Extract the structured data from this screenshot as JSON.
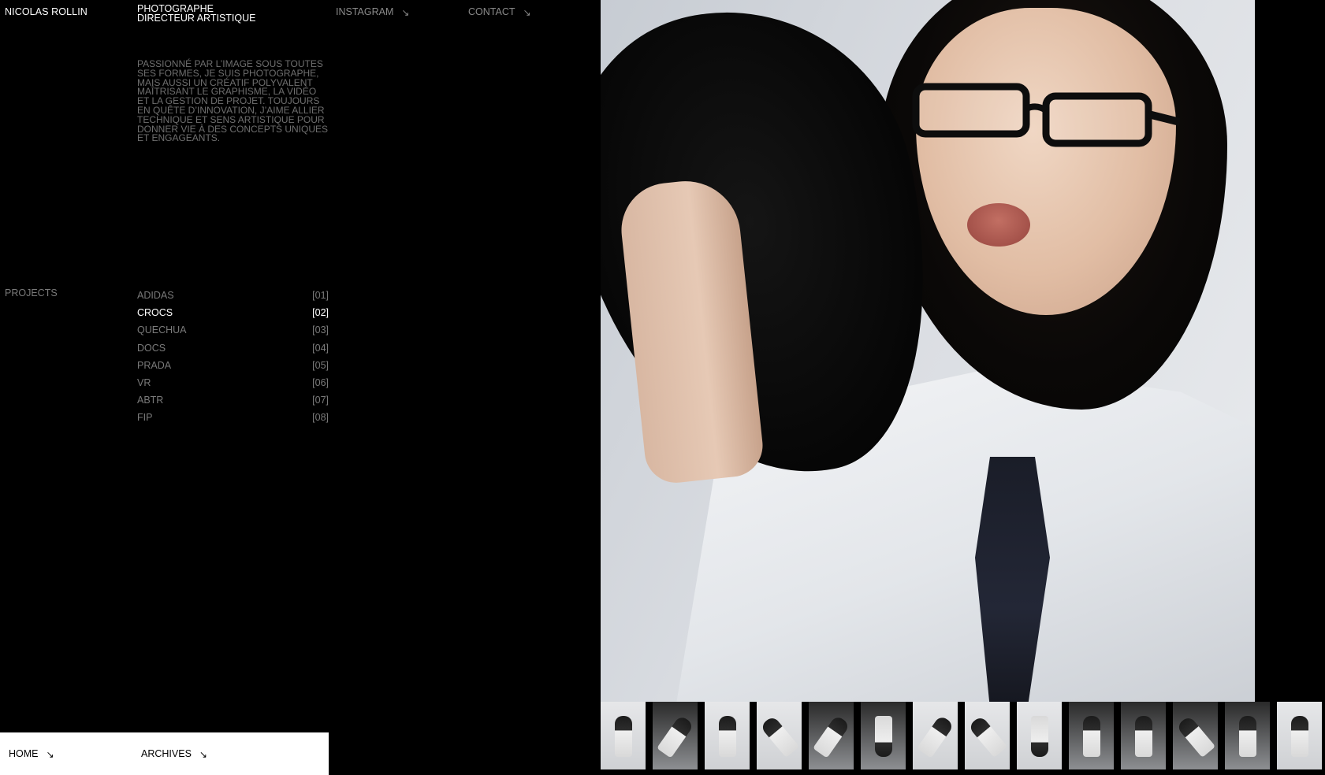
{
  "header": {
    "name": "NICOLAS ROLLIN",
    "role_line1": "PHOTOGRAPHE",
    "role_line2": "DIRECTEUR ARTISTIQUE",
    "instagram_label": "INSTAGRAM",
    "contact_label": "CONTACT",
    "arrow_glyph": "↘"
  },
  "intro": {
    "text": "PASSIONNÉ PAR L’IMAGE SOUS TOUTES SES FORMES, JE SUIS PHOTOGRAPHE, MAIS AUSSI UN CRÉATIF POLYVALENT MAÎTRISANT LE GRAPHISME, LA VIDÉO ET LA GESTION DE PROJET. TOUJOURS EN QUÊTE D’INNOVATION, J’AIME ALLIER TECHNIQUE ET SENS ARTISTIQUE POUR DONNER VIE À DES CONCEPTS UNIQUES ET ENGAGEANTS."
  },
  "projects": {
    "label": "PROJECTS",
    "items": [
      {
        "name": "ADIDAS",
        "index": "[01]",
        "active": false
      },
      {
        "name": "CROCS",
        "index": "[02]",
        "active": true
      },
      {
        "name": "QUECHUA",
        "index": "[03]",
        "active": false
      },
      {
        "name": "DOCS",
        "index": "[04]",
        "active": false
      },
      {
        "name": "PRADA",
        "index": "[05]",
        "active": false
      },
      {
        "name": "VR",
        "index": "[06]",
        "active": false
      },
      {
        "name": "ABTR",
        "index": "[07]",
        "active": false
      },
      {
        "name": "FIP",
        "index": "[08]",
        "active": false
      }
    ]
  },
  "footer": {
    "home_label": "HOME",
    "archives_label": "ARCHIVES"
  },
  "colors": {
    "background": "#000000",
    "text_primary": "#ffffff",
    "text_muted": "#7a7a7a",
    "footer_bar": "#ffffff"
  },
  "thumbnails_count": 14
}
